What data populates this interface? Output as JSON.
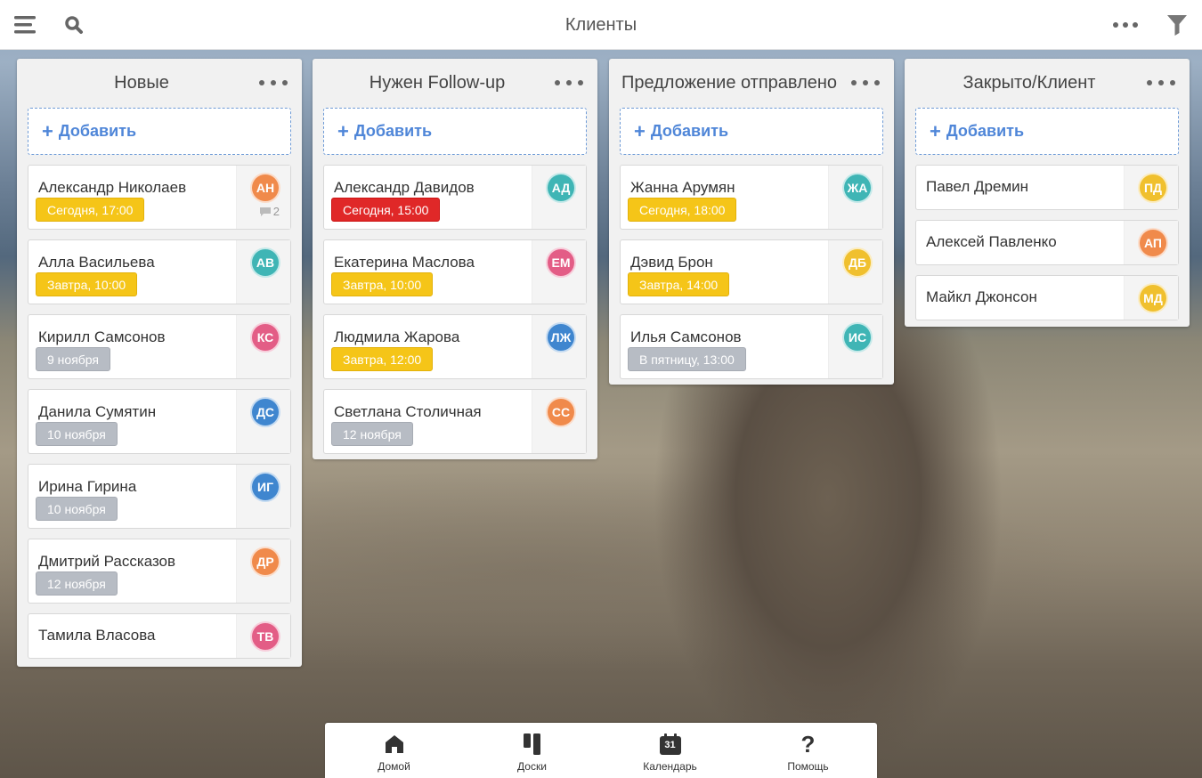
{
  "header": {
    "title": "Клиенты",
    "menu_icon": "hamburger-menu-icon",
    "search_icon": "search-icon",
    "more_icon": "more-horizontal-icon",
    "filter_icon": "filter-icon"
  },
  "add_label": "Добавить",
  "colors": {
    "yellow": "#f5c518",
    "red": "#e02828",
    "gray": "#b7bcc4",
    "accent": "#4f86d8",
    "av_orange": "#f08a4b",
    "av_teal": "#3fb5b5",
    "av_pink": "#e35d86",
    "av_blue": "#3f86cf",
    "av_yellow": "#f0c02e"
  },
  "columns": [
    {
      "title": "Новые",
      "cards": [
        {
          "name": "Александр Николаев",
          "initials": "АН",
          "date": "Сегодня, 17:00",
          "comments": "2"
        },
        {
          "name": "Алла Васильева",
          "initials": "АВ",
          "date": "Завтра, 10:00"
        },
        {
          "name": "Кирилл Самсонов",
          "initials": "КС",
          "date": "9 ноября"
        },
        {
          "name": "Данила Сумятин",
          "initials": "ДС",
          "date": "10 ноября"
        },
        {
          "name": "Ирина Гирина",
          "initials": "ИГ",
          "date": "10 ноября"
        },
        {
          "name": "Дмитрий Рассказов",
          "initials": "ДР",
          "date": "12 ноября"
        },
        {
          "name": "Тамила Власова",
          "initials": "ТВ"
        }
      ]
    },
    {
      "title": "Нужен Follow-up",
      "cards": [
        {
          "name": "Александр Давидов",
          "initials": "АД",
          "date": "Сегодня, 15:00"
        },
        {
          "name": "Екатерина Маслова",
          "initials": "ЕМ",
          "date": "Завтра, 10:00"
        },
        {
          "name": "Людмила Жарова",
          "initials": "ЛЖ",
          "date": "Завтра, 12:00"
        },
        {
          "name": "Светлана Столичная",
          "initials": "СС",
          "date": "12 ноября"
        }
      ]
    },
    {
      "title": "Предложение отправлено",
      "cards": [
        {
          "name": "Жанна Арумян",
          "initials": "ЖА",
          "date": "Сегодня, 18:00"
        },
        {
          "name": "Дэвид Брон",
          "initials": "ДБ",
          "date": "Завтра, 14:00"
        },
        {
          "name": "Илья Самсонов",
          "initials": "ИС",
          "date": "В пятницу, 13:00"
        }
      ]
    },
    {
      "title": "Закрыто/Клиент",
      "cards": [
        {
          "name": "Павел Дремин",
          "initials": "ПД"
        },
        {
          "name": "Алексей Павленко",
          "initials": "АП"
        },
        {
          "name": "Майкл Джонсон",
          "initials": "МД"
        }
      ]
    }
  ],
  "nav": {
    "home": "Домой",
    "boards": "Доски",
    "calendar": "Календарь",
    "calendar_day": "31",
    "help": "Помощь"
  }
}
